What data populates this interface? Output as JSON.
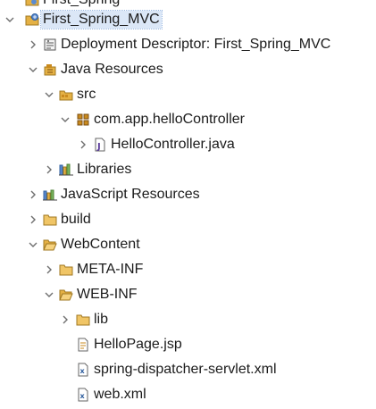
{
  "project_explorer": {
    "clipped_item": {
      "label": "First_Spring",
      "icon": "web-project-icon"
    },
    "items": [
      {
        "label": "First_Spring_MVC",
        "icon": "web-project-icon",
        "state": "expanded",
        "selected": true
      },
      {
        "label": "Deployment Descriptor: First_Spring_MVC",
        "icon": "deployment-descriptor-icon",
        "state": "collapsed"
      },
      {
        "label": "Java Resources",
        "icon": "java-resources-icon",
        "state": "expanded"
      },
      {
        "label": "src",
        "icon": "source-folder-icon",
        "state": "expanded"
      },
      {
        "label": "com.app.helloController",
        "icon": "package-icon",
        "state": "expanded"
      },
      {
        "label": "HelloController.java",
        "icon": "java-file-icon",
        "state": "collapsed"
      },
      {
        "label": "Libraries",
        "icon": "libraries-icon",
        "state": "collapsed"
      },
      {
        "label": "JavaScript Resources",
        "icon": "javascript-resources-icon",
        "state": "collapsed"
      },
      {
        "label": "build",
        "icon": "folder-icon",
        "state": "collapsed"
      },
      {
        "label": "WebContent",
        "icon": "folder-open-icon",
        "state": "expanded"
      },
      {
        "label": "META-INF",
        "icon": "folder-icon",
        "state": "collapsed"
      },
      {
        "label": "WEB-INF",
        "icon": "folder-open-icon",
        "state": "expanded"
      },
      {
        "label": "lib",
        "icon": "folder-icon",
        "state": "collapsed"
      },
      {
        "label": "HelloPage.jsp",
        "icon": "jsp-file-icon",
        "state": "leaf"
      },
      {
        "label": "spring-dispatcher-servlet.xml",
        "icon": "xml-file-icon",
        "state": "leaf"
      },
      {
        "label": "web.xml",
        "icon": "xml-file-icon",
        "state": "leaf"
      }
    ]
  },
  "colors": {
    "selection": "#dbe7f7",
    "twisty": "#6e6e6e",
    "folder": "#e5b144",
    "java": "#c98a1e"
  }
}
